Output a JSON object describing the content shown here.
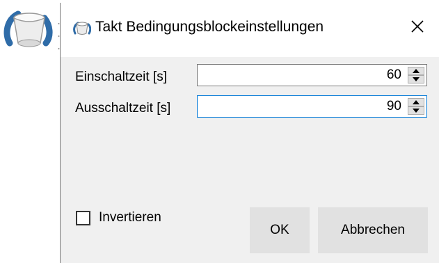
{
  "window": {
    "title": "Takt Bedingungsblockeinstellungen",
    "icon": "app-cup-icon",
    "close_icon": "close-icon"
  },
  "fields": {
    "on_time": {
      "label": "Einschaltzeit [s]",
      "value": "60"
    },
    "off_time": {
      "label": "Ausschaltzeit [s]",
      "value": "90"
    }
  },
  "options": {
    "invert_label": "Invertieren",
    "invert_checked": false
  },
  "buttons": {
    "ok_label": "OK",
    "cancel_label": "Abbrechen"
  },
  "colors": {
    "dialog_bg": "#f0f0f0",
    "button_bg": "#e1e1e1",
    "focus_border": "#0078d7",
    "icon_blue": "#2f6ca8"
  }
}
